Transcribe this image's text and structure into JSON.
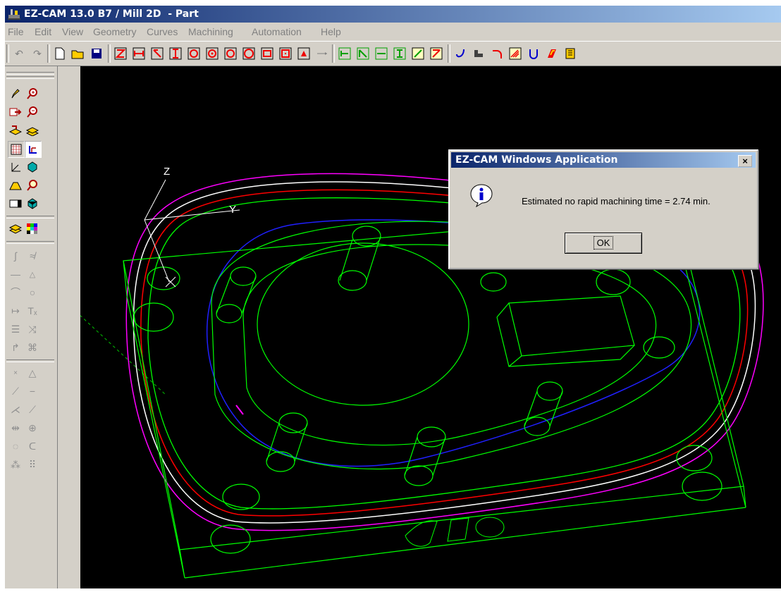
{
  "window": {
    "title": "EZ-CAM 13.0 B7 / Mill 2D  - Part"
  },
  "menu": [
    "File",
    "Edit",
    "View",
    "Geometry",
    "Curves",
    "Machining",
    "Automation",
    "Help"
  ],
  "viewport": {
    "axis_z": "Z",
    "axis_y": "Y"
  },
  "dialog": {
    "title": "EZ-CAM Windows Application",
    "close": "×",
    "message": "Estimated no rapid machining time = 2.74 min.",
    "ok": "OK"
  }
}
